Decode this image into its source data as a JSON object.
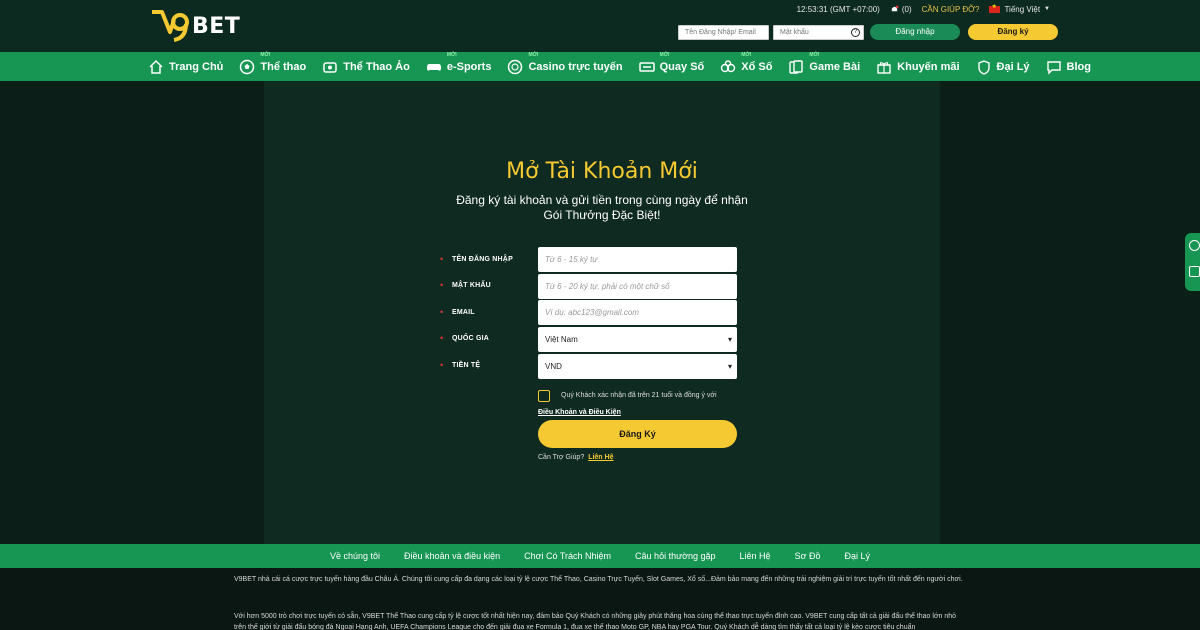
{
  "brand": {
    "logo_text": "BET",
    "logo_mark": "V9",
    "accent": "#f5c931",
    "green": "#169553"
  },
  "topbar": {
    "time": "12:53:31",
    "timezone": "(GMT +07:00)",
    "notifications": "(0)",
    "help": "CẦN GIÚP ĐỠ?",
    "language": "Tiếng Việt"
  },
  "login": {
    "user_placeholder": "Tên Đăng Nhập/ Email",
    "pass_placeholder": "Mật khẩu",
    "login_label": "Đăng nhập",
    "register_label": "Đăng ký"
  },
  "nav": {
    "new_badge": "MỚI",
    "items": [
      {
        "label": "Trang Chủ",
        "icon": "home-icon"
      },
      {
        "label": "Thể thao",
        "icon": "soccer-ball-icon"
      },
      {
        "label": "Thể Thao Ảo",
        "icon": "virtual-sports-icon"
      },
      {
        "label": "e-Sports",
        "icon": "gamepad-icon"
      },
      {
        "label": "Casino trực tuyến",
        "icon": "casino-chip-icon"
      },
      {
        "label": "Quay Số",
        "icon": "lottery-icon"
      },
      {
        "label": "Xổ Số",
        "icon": "lotto-balls-icon"
      },
      {
        "label": "Game Bài",
        "icon": "cards-icon"
      },
      {
        "label": "Khuyến mãi",
        "icon": "gift-icon"
      },
      {
        "label": "Đại Lý",
        "icon": "agent-icon"
      },
      {
        "label": "Blog",
        "icon": "chat-icon"
      }
    ]
  },
  "form": {
    "title": "Mở Tài Khoản Mới",
    "subtitle_line1": "Đăng ký tài khoản và gửi tiền trong cùng ngày để nhận",
    "subtitle_line2": "Gói Thưởng Đặc Biệt!",
    "required_mark": "•",
    "fields": [
      {
        "label": "TÊN ĐĂNG NHẬP",
        "placeholder": "Từ 6 - 15 ký tự"
      },
      {
        "label": "MẬT KHẨU",
        "placeholder": "Từ 6 - 20 ký tự, phải có một chữ số"
      },
      {
        "label": "EMAIL",
        "placeholder": "Ví dụ: abc123@gmail.com"
      },
      {
        "label": "QUỐC GIA",
        "value": "Việt Nam"
      },
      {
        "label": "TIỀN TỆ",
        "value": "VND"
      }
    ],
    "agree_text": "Quý Khách xác nhận đã trên 21 tuổi và đồng ý với",
    "terms_link": "Điều Khoản và Điều Kiện",
    "submit_label": "Đăng Ký",
    "help_text": "Cần Trợ Giúp?",
    "help_link": "Liên Hệ"
  },
  "footer": {
    "links": [
      "Về chúng tôi",
      "Điều khoản và điều kiện",
      "Chơi Có Trách Nhiệm",
      "Câu hỏi thường gặp",
      "Liên Hệ",
      "Sơ Đồ",
      "Đại Lý"
    ],
    "para1": "V9BET nhà cái cá cược trực tuyến hàng đầu Châu Á. Chúng tôi cung cấp đa dạng các loại tỷ lệ cược Thể Thao, Casino Trực Tuyến, Slot Games, Xổ số...Đảm bảo mang đến những trải nghiệm giải trí trực tuyến tốt nhất đến người chơi.",
    "para2": "Với hơn 5000 trò chơi trực tuyến có sẵn, V9BET Thể Thao cung cấp tỷ lệ cược tốt nhất hiện nay, đảm bảo Quý Khách có những giây phút thăng hoa cùng thể thao trực tuyến đỉnh cao. V9BET cung cấp tất cả giải đấu thể thao lớn nhỏ trên thế giới từ giải đấu bóng đá Ngoại Hạng Anh, UEFA Champions League cho đến giải đua xe Formula 1, đua xe thể thao Moto GP, NBA hay PGA Tour. Quý Khách dễ dàng tìm thấy tất cả loại tỷ lệ kèo cược tiêu chuẩn"
  }
}
